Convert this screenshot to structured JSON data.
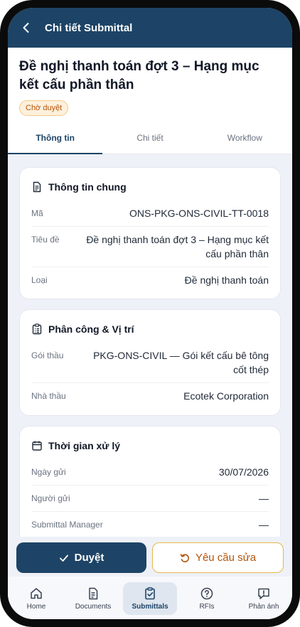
{
  "appbar": {
    "title": "Chi tiết Submittal"
  },
  "document": {
    "title": "Đề nghị thanh toán đợt 3 – Hạng mục kết cấu phần thân",
    "status": "Chờ duyệt"
  },
  "tabs": [
    {
      "label": "Thông tin",
      "active": true
    },
    {
      "label": "Chi tiết",
      "active": false
    },
    {
      "label": "Workflow",
      "active": false
    }
  ],
  "general": {
    "title": "Thông tin chung",
    "rows": [
      {
        "label": "Mã",
        "value": "ONS-PKG-ONS-CIVIL-TT-0018"
      },
      {
        "label": "Tiêu đề",
        "value": "Đề nghị thanh toán đợt 3 – Hạng mục kết cấu phần thân"
      },
      {
        "label": "Loại",
        "value": "Đề nghị thanh toán"
      }
    ]
  },
  "assignment": {
    "title": "Phân công & Vị trí",
    "rows": [
      {
        "label": "Gói thầu",
        "value": "PKG-ONS-CIVIL — Gói kết cấu bê tông cốt thép"
      },
      {
        "label": "Nhà thầu",
        "value": "Ecotek Corporation"
      }
    ]
  },
  "timing": {
    "title": "Thời gian xử lý",
    "rows": [
      {
        "label": "Ngày gửi",
        "value": "30/07/2026"
      },
      {
        "label": "Người gửi",
        "value": "—"
      },
      {
        "label": "Submittal Manager",
        "value": "—"
      }
    ]
  },
  "actions": {
    "approve": "Duyệt",
    "revise": "Yêu cầu sửa"
  },
  "nav": [
    {
      "label": "Home",
      "icon": "home-icon"
    },
    {
      "label": "Documents",
      "icon": "document-icon"
    },
    {
      "label": "Submittals",
      "icon": "clipboard-check-icon"
    },
    {
      "label": "RFIs",
      "icon": "question-circle-icon"
    },
    {
      "label": "Phản ánh",
      "icon": "feedback-icon"
    }
  ],
  "colors": {
    "primary": "#1d4466",
    "warning": "#b45309",
    "warning_bg": "#fdf0dc"
  }
}
